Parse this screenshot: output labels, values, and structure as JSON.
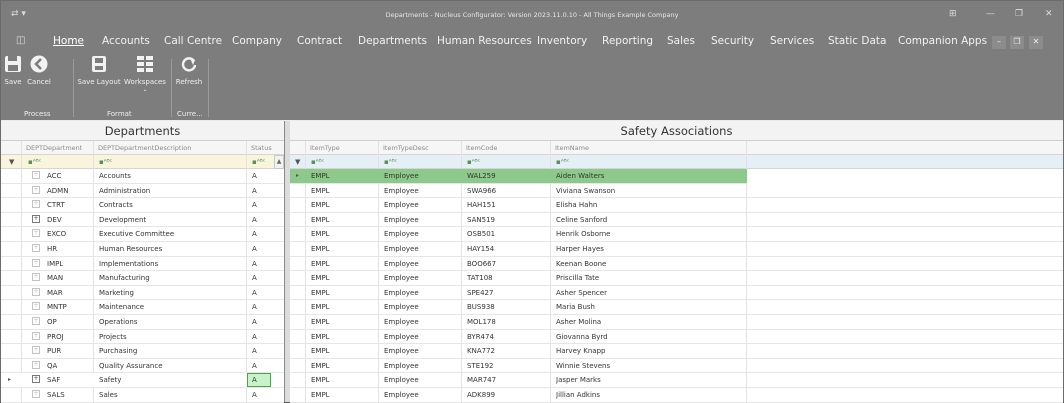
{
  "titlebar": {
    "title": "Departments - Nucleus Configurator: Version 2023.11.0.10 - All Things Example Company"
  },
  "menu": {
    "items": [
      "Home",
      "Accounts",
      "Call Centre",
      "Company",
      "Contract",
      "Departments",
      "Human Resources",
      "Inventory",
      "Reporting",
      "Sales",
      "Security",
      "Services",
      "Static Data",
      "Companion Apps"
    ]
  },
  "ribbon": {
    "buttons": [
      "Save",
      "Cancel",
      "Save Layout",
      "Workspaces",
      "Refresh"
    ],
    "groups": [
      "Process",
      "Format",
      "Curre..."
    ]
  },
  "departments": {
    "title": "Departments",
    "columns": [
      "DEPTDepartment",
      "DEPTDepartmentDescription",
      "Status"
    ],
    "filter_icon": "filter-icon",
    "rows": [
      {
        "code": "ACC",
        "desc": "Accounts",
        "status": "A"
      },
      {
        "code": "ADMN",
        "desc": "Administration",
        "status": "A"
      },
      {
        "code": "CTRT",
        "desc": "Contracts",
        "status": "A"
      },
      {
        "code": "DEV",
        "desc": "Development",
        "status": "A"
      },
      {
        "code": "EXCO",
        "desc": "Executive Committee",
        "status": "A"
      },
      {
        "code": "HR",
        "desc": "Human Resources",
        "status": "A"
      },
      {
        "code": "IMPL",
        "desc": "Implementations",
        "status": "A"
      },
      {
        "code": "MAN",
        "desc": "Manufacturing",
        "status": "A"
      },
      {
        "code": "MAR",
        "desc": "Marketing",
        "status": "A"
      },
      {
        "code": "MNTP",
        "desc": "Maintenance",
        "status": "A"
      },
      {
        "code": "OP",
        "desc": "Operations",
        "status": "A"
      },
      {
        "code": "PROJ",
        "desc": "Projects",
        "status": "A"
      },
      {
        "code": "PUR",
        "desc": "Purchasing",
        "status": "A"
      },
      {
        "code": "QA",
        "desc": "Quality Assurance",
        "status": "A"
      },
      {
        "code": "SAF",
        "desc": "Safety",
        "status": "A"
      },
      {
        "code": "SALS",
        "desc": "Sales",
        "status": "A"
      }
    ],
    "selected_index": 14,
    "expanded_plus": [
      3,
      14
    ]
  },
  "safety": {
    "title": "Safety Associations",
    "columns": [
      "ItemType",
      "ItemTypeDesc",
      "ItemCode",
      "ItemName"
    ],
    "rows": [
      {
        "type": "EMPL",
        "typedesc": "Employee",
        "code": "WAL259",
        "name": "Aiden Walters"
      },
      {
        "type": "EMPL",
        "typedesc": "Employee",
        "code": "SWA966",
        "name": "Viviana Swanson"
      },
      {
        "type": "EMPL",
        "typedesc": "Employee",
        "code": "HAH151",
        "name": "Elisha Hahn"
      },
      {
        "type": "EMPL",
        "typedesc": "Employee",
        "code": "SAN519",
        "name": "Celine Sanford"
      },
      {
        "type": "EMPL",
        "typedesc": "Employee",
        "code": "OSB501",
        "name": "Henrik Osborne"
      },
      {
        "type": "EMPL",
        "typedesc": "Employee",
        "code": "HAY154",
        "name": "Harper Hayes"
      },
      {
        "type": "EMPL",
        "typedesc": "Employee",
        "code": "BOO667",
        "name": "Keenan Boone"
      },
      {
        "type": "EMPL",
        "typedesc": "Employee",
        "code": "TAT108",
        "name": "Priscilla Tate"
      },
      {
        "type": "EMPL",
        "typedesc": "Employee",
        "code": "SPE427",
        "name": "Asher Spencer"
      },
      {
        "type": "EMPL",
        "typedesc": "Employee",
        "code": "BUS938",
        "name": "Maria Bush"
      },
      {
        "type": "EMPL",
        "typedesc": "Employee",
        "code": "MOL178",
        "name": "Asher Molina"
      },
      {
        "type": "EMPL",
        "typedesc": "Employee",
        "code": "BYR474",
        "name": "Giovanna Byrd"
      },
      {
        "type": "EMPL",
        "typedesc": "Employee",
        "code": "KNA772",
        "name": "Harvey Knapp"
      },
      {
        "type": "EMPL",
        "typedesc": "Employee",
        "code": "STE192",
        "name": "Winnie Stevens"
      },
      {
        "type": "EMPL",
        "typedesc": "Employee",
        "code": "MAR747",
        "name": "Jasper Marks"
      },
      {
        "type": "EMPL",
        "typedesc": "Employee",
        "code": "ADK899",
        "name": "Jillian Adkins"
      }
    ],
    "selected_index": 0
  },
  "colors": {
    "chrome": "#7d7d7d",
    "filter_row": "#f8f5dc",
    "selected_green": "#8cc98a",
    "status_box": "#c8f2c8"
  }
}
